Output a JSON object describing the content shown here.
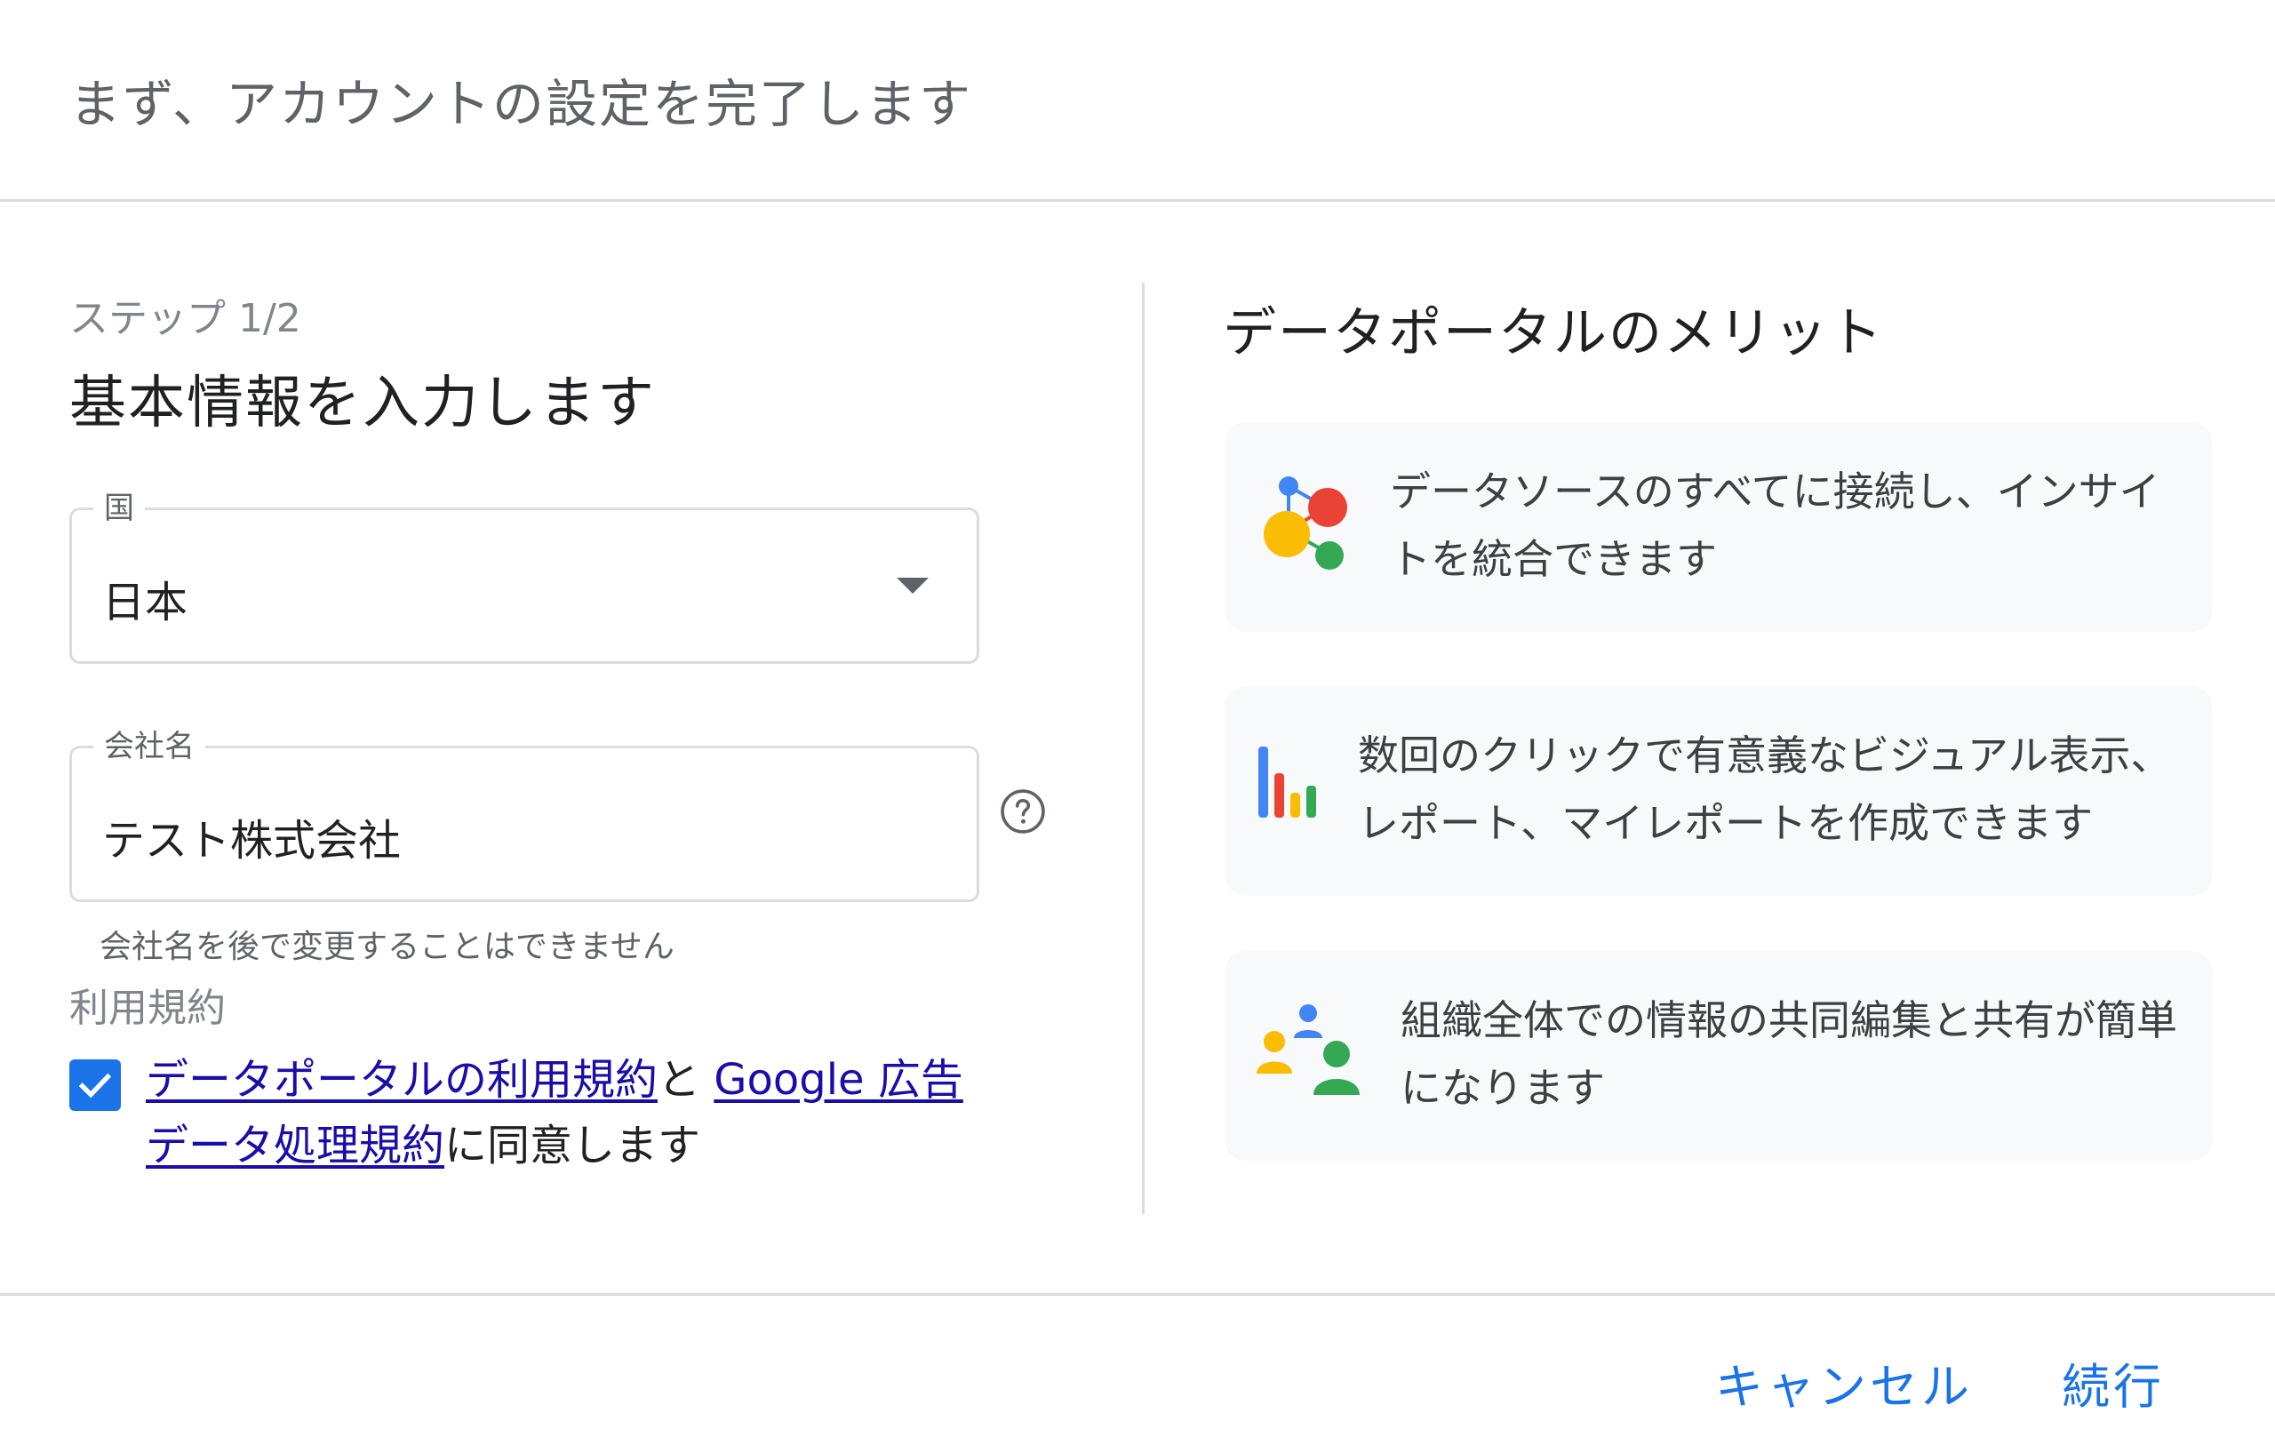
{
  "dialog": {
    "title": "まず、アカウントの設定を完了します"
  },
  "form": {
    "step_label": "ステップ 1/2",
    "heading": "基本情報を入力します",
    "country": {
      "label": "国",
      "value": "日本"
    },
    "company": {
      "label": "会社名",
      "value": "テスト株式会社",
      "helper": "会社名を後で変更することはできません"
    },
    "terms": {
      "heading": "利用規約",
      "checked": true,
      "link1": "データポータルの利用規約",
      "connector": "と",
      "link2": "Google 広告データ処理規約",
      "suffix": "に同意します"
    }
  },
  "benefits": {
    "heading": "データポータルのメリット",
    "items": [
      {
        "icon": "connected-data-icon",
        "text": "データソースのすべてに接続し、インサイトを統合できます"
      },
      {
        "icon": "bar-chart-icon",
        "text": "数回のクリックで有意義なビジュアル表示、レポート、マイレポートを作成できます"
      },
      {
        "icon": "people-collaboration-icon",
        "text": "組織全体での情報の共同編集と共有が簡単になります"
      }
    ]
  },
  "footer": {
    "cancel_label": "キャンセル",
    "continue_label": "続行"
  },
  "colors": {
    "accent": "#1a73e8",
    "link": "#1a0dab",
    "google_blue": "#4285f4",
    "google_red": "#ea4335",
    "google_yellow": "#fbbc04",
    "google_green": "#34a853"
  }
}
